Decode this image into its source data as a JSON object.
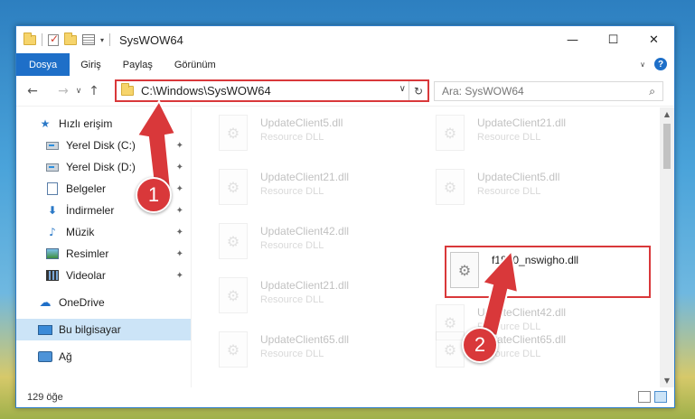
{
  "window": {
    "title": "SysWOW64",
    "controls": {
      "minimize": "—",
      "maximize": "☐",
      "close": "✕"
    }
  },
  "ribbon": {
    "tabs": [
      {
        "label": "Dosya"
      },
      {
        "label": "Giriş"
      },
      {
        "label": "Paylaş"
      },
      {
        "label": "Görünüm"
      }
    ],
    "expand_icon": "chevron-down-icon",
    "help": "?"
  },
  "nav": {
    "back": "←",
    "forward": "→",
    "recent": "∨",
    "up": "↑",
    "address": "C:\\Windows\\SysWOW64",
    "address_dropdown": "∨",
    "refresh": "↻",
    "search_placeholder": "Ara: SysWOW64",
    "search_icon": "⌕"
  },
  "sidebar": {
    "items": [
      {
        "label": "Hızlı erişim",
        "icon": "star-icon"
      },
      {
        "label": "Yerel Disk (C:)",
        "icon": "disk-icon",
        "pinned": true
      },
      {
        "label": "Yerel Disk (D:)",
        "icon": "disk-icon",
        "pinned": true
      },
      {
        "label": "Belgeler",
        "icon": "document-icon",
        "pinned": true
      },
      {
        "label": "İndirmeler",
        "icon": "download-icon",
        "pinned": true
      },
      {
        "label": "Müzik",
        "icon": "music-icon",
        "pinned": true
      },
      {
        "label": "Resimler",
        "icon": "picture-icon",
        "pinned": true
      },
      {
        "label": "Videolar",
        "icon": "video-icon",
        "pinned": true
      },
      {
        "label": "OneDrive",
        "icon": "cloud-icon"
      },
      {
        "label": "Bu bilgisayar",
        "icon": "computer-icon",
        "selected": true
      },
      {
        "label": "Ağ",
        "icon": "network-icon"
      }
    ],
    "pin_glyph": "📌"
  },
  "files": [
    {
      "name": "UpdateClient5.dll",
      "type": "Resource DLL",
      "faded": true
    },
    {
      "name": "UpdateClient21.dll",
      "type": "Resource DLL",
      "faded": true
    },
    {
      "name": "UpdateClient21.dll",
      "type": "Resource DLL",
      "faded": true
    },
    {
      "name": "UpdateClient5.dll",
      "type": "Resource DLL",
      "faded": true
    },
    {
      "name": "UpdateClient42.dll",
      "type": "Resource DLL",
      "faded": true
    },
    {
      "name": "f1860_nswigho.dll",
      "type": "",
      "faded": false
    },
    {
      "name": "UpdateClient21.dll",
      "type": "Resource DLL",
      "faded": true
    },
    {
      "name": "UpdateClient42.dll",
      "type": "Resource DLL",
      "faded": true
    },
    {
      "name": "UpdateClient65.dll",
      "type": "Resource DLL",
      "faded": true
    },
    {
      "name": "UpdateClient65.dll",
      "type": "Resource DLL",
      "faded": true
    }
  ],
  "status": {
    "count": "129 öğe"
  },
  "callouts": {
    "one": "1",
    "two": "2"
  },
  "colors": {
    "accent": "#1e6fc8",
    "highlight": "#d9383a"
  }
}
